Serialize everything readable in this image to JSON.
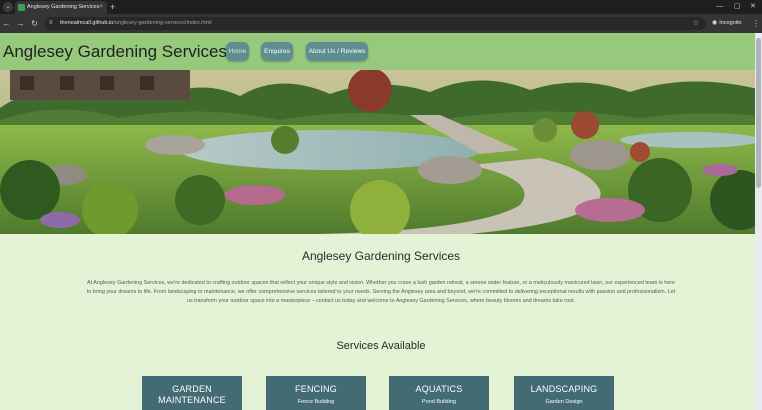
{
  "browser": {
    "tab_title": "Anglesey Gardening Services",
    "tab_close": "×",
    "new_tab": "+",
    "url_host": "thenealmcall.github.io",
    "url_path": "/anglesey-gardening-services/index.html",
    "profile_label": "Incognito",
    "icons": {
      "back": "←",
      "forward": "→",
      "reload": "↻",
      "site_info": "≡",
      "star": "☆",
      "incognito": "◉",
      "menu": "⋮",
      "minimize": "—",
      "maximize": "▢",
      "close": "✕",
      "tab_search": "⌄"
    }
  },
  "site": {
    "title": "Anglesey Gardening Services",
    "nav": [
      {
        "label": "Home",
        "active": true
      },
      {
        "label": "Enquires",
        "active": false
      },
      {
        "label": "About Us / Reviews",
        "active": false
      }
    ],
    "hero_alt": "",
    "colors": {
      "header_bg": "#97c97d",
      "page_bg": "#e4f3d5",
      "nav_pill": "#5e8e8f",
      "card_bg": "#436b73"
    }
  },
  "main": {
    "heading": "Anglesey Gardening Services",
    "intro": "At Anglesey Gardening Services, we're dedicated to crafting outdoor spaces that reflect your unique style and vision. Whether you crave a lush garden retreat, a serene water feature, or a meticulously manicured lawn, our experienced team is here to bring your dreams to life. From landscaping to maintenance, we offer comprehensive services tailored to your needs. Serving the Anglesey area and beyond, we're committed to delivering exceptional results with passion and professionalism. Let us transform your outdoor space into a masterpiece – contact us today and welcome to Anglesey Gardening Services, where beauty blooms and dreams take root.",
    "services_heading": "Services Available",
    "services": [
      {
        "title": "GARDEN MAINTENANCE",
        "subtitle": ""
      },
      {
        "title": "FENCING",
        "subtitle": "Fence Building"
      },
      {
        "title": "AQUATICS",
        "subtitle": "Pond Building"
      },
      {
        "title": "LANDSCAPING",
        "subtitle": "Garden Design"
      }
    ]
  }
}
